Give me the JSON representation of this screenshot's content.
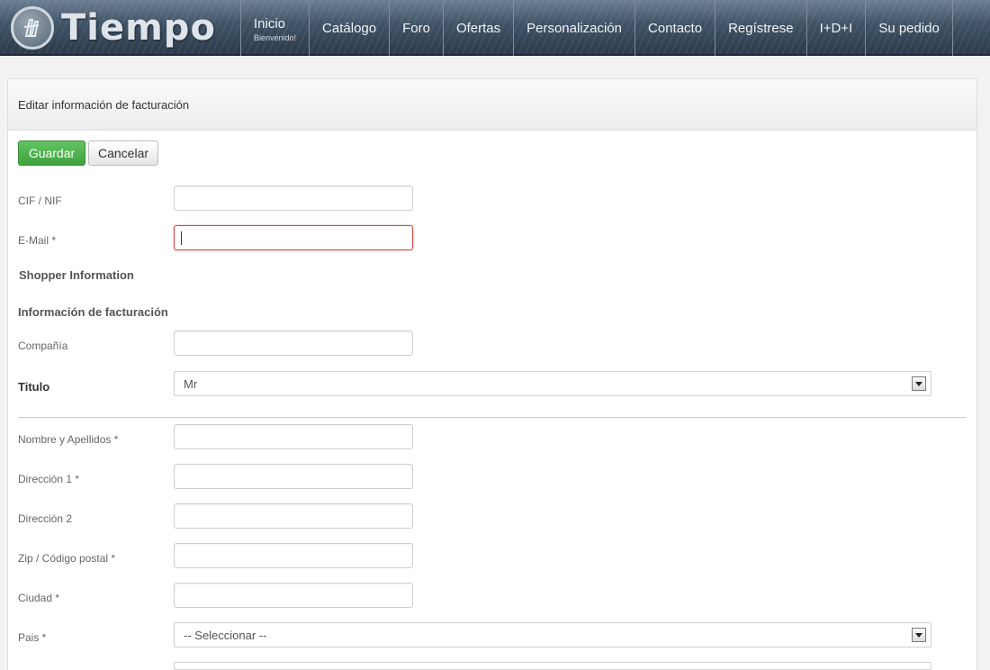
{
  "header": {
    "logo_text": "Tiempo",
    "nav": [
      {
        "label": "Inicio",
        "sub": "Bienvenido!"
      },
      {
        "label": "Catálogo"
      },
      {
        "label": "Foro"
      },
      {
        "label": "Ofertas"
      },
      {
        "label": "Personalización"
      },
      {
        "label": "Contacto"
      },
      {
        "label": "Regístrese"
      },
      {
        "label": "I+D+I"
      },
      {
        "label": "Su pedido"
      }
    ]
  },
  "panel": {
    "title": "Editar información de facturación",
    "save_label": "Guardar",
    "cancel_label": "Cancelar"
  },
  "form": {
    "cif_label": "CIF / NIF",
    "email_label": "E-Mail *",
    "shopper_heading": "Shopper Information",
    "billing_heading": "Información de facturación",
    "company_label": "Compañía",
    "title_label": "Titulo",
    "title_value": "Mr",
    "name_label": "Nombre y Apellidos *",
    "address1_label": "Dirección 1 *",
    "address2_label": "Dirección 2",
    "zip_label": "Zip / Código postal *",
    "city_label": "Ciudad *",
    "country_label": "Pais *",
    "country_value": "-- Seleccionar --"
  },
  "colors": {
    "save_button": "#4cae4c",
    "error_border": "#d24a4a",
    "header_bg": "#3f5266"
  }
}
